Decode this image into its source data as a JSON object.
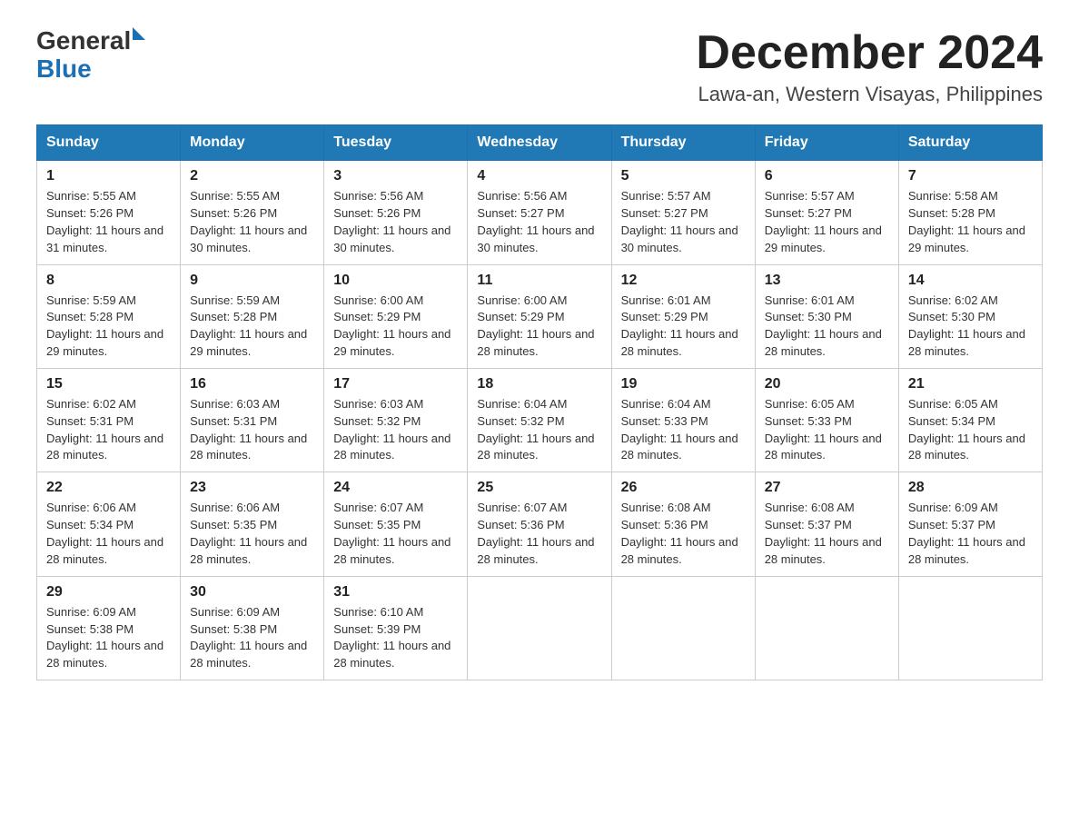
{
  "header": {
    "logo_general": "General",
    "logo_blue": "Blue",
    "month_title": "December 2024",
    "location": "Lawa-an, Western Visayas, Philippines"
  },
  "days_of_week": [
    "Sunday",
    "Monday",
    "Tuesday",
    "Wednesday",
    "Thursday",
    "Friday",
    "Saturday"
  ],
  "weeks": [
    [
      {
        "day": "1",
        "sunrise": "5:55 AM",
        "sunset": "5:26 PM",
        "daylight": "11 hours and 31 minutes."
      },
      {
        "day": "2",
        "sunrise": "5:55 AM",
        "sunset": "5:26 PM",
        "daylight": "11 hours and 30 minutes."
      },
      {
        "day": "3",
        "sunrise": "5:56 AM",
        "sunset": "5:26 PM",
        "daylight": "11 hours and 30 minutes."
      },
      {
        "day": "4",
        "sunrise": "5:56 AM",
        "sunset": "5:27 PM",
        "daylight": "11 hours and 30 minutes."
      },
      {
        "day": "5",
        "sunrise": "5:57 AM",
        "sunset": "5:27 PM",
        "daylight": "11 hours and 30 minutes."
      },
      {
        "day": "6",
        "sunrise": "5:57 AM",
        "sunset": "5:27 PM",
        "daylight": "11 hours and 29 minutes."
      },
      {
        "day": "7",
        "sunrise": "5:58 AM",
        "sunset": "5:28 PM",
        "daylight": "11 hours and 29 minutes."
      }
    ],
    [
      {
        "day": "8",
        "sunrise": "5:59 AM",
        "sunset": "5:28 PM",
        "daylight": "11 hours and 29 minutes."
      },
      {
        "day": "9",
        "sunrise": "5:59 AM",
        "sunset": "5:28 PM",
        "daylight": "11 hours and 29 minutes."
      },
      {
        "day": "10",
        "sunrise": "6:00 AM",
        "sunset": "5:29 PM",
        "daylight": "11 hours and 29 minutes."
      },
      {
        "day": "11",
        "sunrise": "6:00 AM",
        "sunset": "5:29 PM",
        "daylight": "11 hours and 28 minutes."
      },
      {
        "day": "12",
        "sunrise": "6:01 AM",
        "sunset": "5:29 PM",
        "daylight": "11 hours and 28 minutes."
      },
      {
        "day": "13",
        "sunrise": "6:01 AM",
        "sunset": "5:30 PM",
        "daylight": "11 hours and 28 minutes."
      },
      {
        "day": "14",
        "sunrise": "6:02 AM",
        "sunset": "5:30 PM",
        "daylight": "11 hours and 28 minutes."
      }
    ],
    [
      {
        "day": "15",
        "sunrise": "6:02 AM",
        "sunset": "5:31 PM",
        "daylight": "11 hours and 28 minutes."
      },
      {
        "day": "16",
        "sunrise": "6:03 AM",
        "sunset": "5:31 PM",
        "daylight": "11 hours and 28 minutes."
      },
      {
        "day": "17",
        "sunrise": "6:03 AM",
        "sunset": "5:32 PM",
        "daylight": "11 hours and 28 minutes."
      },
      {
        "day": "18",
        "sunrise": "6:04 AM",
        "sunset": "5:32 PM",
        "daylight": "11 hours and 28 minutes."
      },
      {
        "day": "19",
        "sunrise": "6:04 AM",
        "sunset": "5:33 PM",
        "daylight": "11 hours and 28 minutes."
      },
      {
        "day": "20",
        "sunrise": "6:05 AM",
        "sunset": "5:33 PM",
        "daylight": "11 hours and 28 minutes."
      },
      {
        "day": "21",
        "sunrise": "6:05 AM",
        "sunset": "5:34 PM",
        "daylight": "11 hours and 28 minutes."
      }
    ],
    [
      {
        "day": "22",
        "sunrise": "6:06 AM",
        "sunset": "5:34 PM",
        "daylight": "11 hours and 28 minutes."
      },
      {
        "day": "23",
        "sunrise": "6:06 AM",
        "sunset": "5:35 PM",
        "daylight": "11 hours and 28 minutes."
      },
      {
        "day": "24",
        "sunrise": "6:07 AM",
        "sunset": "5:35 PM",
        "daylight": "11 hours and 28 minutes."
      },
      {
        "day": "25",
        "sunrise": "6:07 AM",
        "sunset": "5:36 PM",
        "daylight": "11 hours and 28 minutes."
      },
      {
        "day": "26",
        "sunrise": "6:08 AM",
        "sunset": "5:36 PM",
        "daylight": "11 hours and 28 minutes."
      },
      {
        "day": "27",
        "sunrise": "6:08 AM",
        "sunset": "5:37 PM",
        "daylight": "11 hours and 28 minutes."
      },
      {
        "day": "28",
        "sunrise": "6:09 AM",
        "sunset": "5:37 PM",
        "daylight": "11 hours and 28 minutes."
      }
    ],
    [
      {
        "day": "29",
        "sunrise": "6:09 AM",
        "sunset": "5:38 PM",
        "daylight": "11 hours and 28 minutes."
      },
      {
        "day": "30",
        "sunrise": "6:09 AM",
        "sunset": "5:38 PM",
        "daylight": "11 hours and 28 minutes."
      },
      {
        "day": "31",
        "sunrise": "6:10 AM",
        "sunset": "5:39 PM",
        "daylight": "11 hours and 28 minutes."
      },
      null,
      null,
      null,
      null
    ]
  ]
}
